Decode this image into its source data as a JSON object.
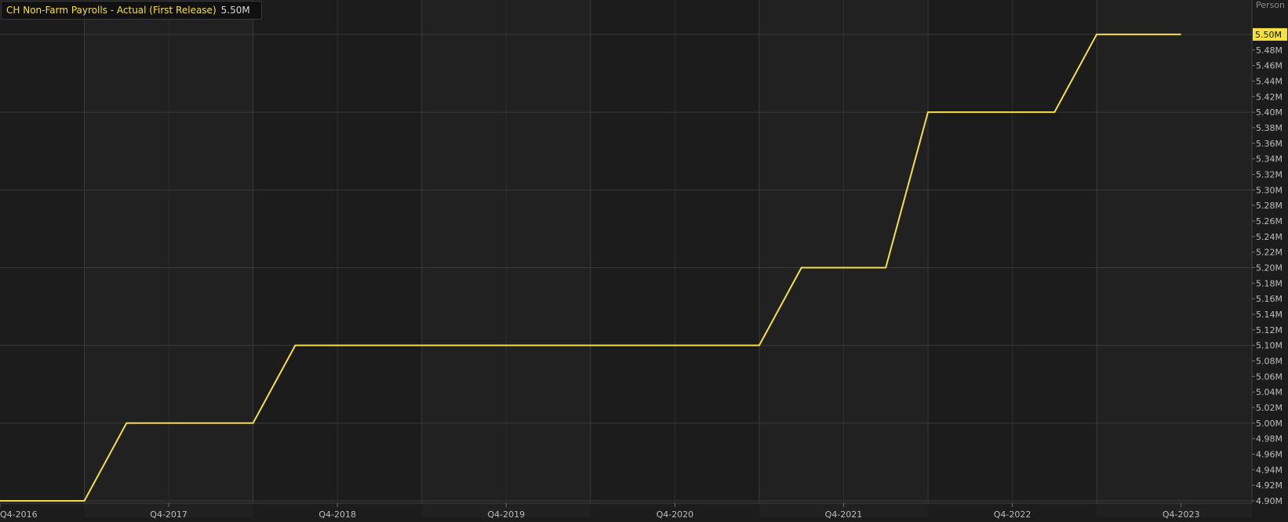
{
  "legend": {
    "series_label": "CH Non-Farm Payrolls - Actual (First Release)",
    "current_value": "5.50M"
  },
  "y_unit_label": "Person",
  "colors": {
    "background": "#1c1c1d",
    "band_alt": "#212122",
    "grid": "#3a3a3c",
    "series_line": "#f5e042",
    "axis_text": "#bdbdbd",
    "last_value_badge": "#f5e042"
  },
  "chart_data": {
    "type": "line",
    "title": "",
    "xlabel": "",
    "ylabel": "Person",
    "x_ticks": [
      "Q4-2016",
      "Q4-2017",
      "Q4-2018",
      "Q4-2019",
      "Q4-2020",
      "Q4-2021",
      "Q4-2022",
      "Q4-2023"
    ],
    "y_ticks": [
      "4.90M",
      "4.92M",
      "4.94M",
      "4.96M",
      "4.98M",
      "5.00M",
      "5.02M",
      "5.04M",
      "5.06M",
      "5.08M",
      "5.10M",
      "5.12M",
      "5.14M",
      "5.16M",
      "5.18M",
      "5.20M",
      "5.22M",
      "5.24M",
      "5.26M",
      "5.28M",
      "5.30M",
      "5.32M",
      "5.34M",
      "5.36M",
      "5.38M",
      "5.40M",
      "5.42M",
      "5.44M",
      "5.46M",
      "5.48M",
      "5.50M"
    ],
    "ylim": [
      4.9,
      5.51
    ],
    "xlim": [
      2016.75,
      2024.17
    ],
    "grid": true,
    "series": [
      {
        "name": "CH Non-Farm Payrolls - Actual (First Release)",
        "color": "#f5e042",
        "x": [
          2016.75,
          2017.25,
          2017.5,
          2018.25,
          2018.5,
          2021.25,
          2021.5,
          2022.0,
          2022.25,
          2023.0,
          2023.25,
          2023.75
        ],
        "y": [
          4.9,
          4.9,
          5.0,
          5.0,
          5.1,
          5.1,
          5.2,
          5.2,
          5.4,
          5.4,
          5.5,
          5.5
        ]
      }
    ],
    "last_value_label": "5.50M"
  }
}
